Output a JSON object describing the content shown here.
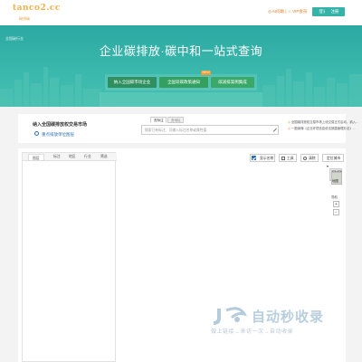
{
  "header": {
    "logo_text": "tanco2.cc",
    "logo_sub": "碳排碳",
    "links": "◎ AI问助 | ☆ VIP会员",
    "login": "登录",
    "register": "注册"
  },
  "hero": {
    "breadcrumb": "全国碳行业",
    "title": "企业碳排放·碳中和一站式查询",
    "buttons": [
      {
        "label": "纳入全国碳市场企业"
      },
      {
        "label": "全国双碳政策通知"
      },
      {
        "label": "碳减排案例集成"
      }
    ],
    "new_badge": "NEW"
  },
  "info": {
    "title": "纳入全国碳排放权交易市场",
    "subtitle": "重点排放单位图层",
    "tabs": [
      "查标注",
      "查地址"
    ],
    "search_placeholder": "搜索已有标注、可输入标注名称或属性值",
    "news": [
      "全国碳排放权交易市场上线交易正式启动，纳入...",
      "一图读懂《企业环境信息依法披露管理办法》..."
    ]
  },
  "map": {
    "panel_tabs": [
      "图层",
      "标注",
      "地区",
      "行业",
      "筛选"
    ],
    "show_name": "显示名称",
    "tools": "工具",
    "clear": "清除",
    "locate_city": "定位城市",
    "thumb_label": "地图",
    "nav_label": "导航",
    "zoom_in": "+",
    "zoom_out": "−"
  },
  "watermark": {
    "brand": "自动秒收录",
    "slogan": "做上链接→来访一次→自动收录"
  },
  "colors": {
    "accent": "#34b3a8",
    "hero": "#2ba9a2",
    "orange": "#e07820",
    "link_blue": "#2a6fb0"
  }
}
